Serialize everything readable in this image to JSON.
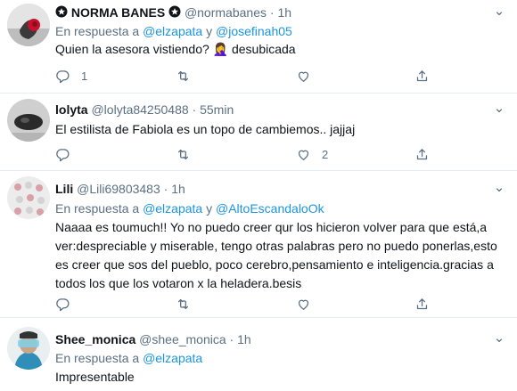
{
  "tweets": [
    {
      "name": "NORMA BANES",
      "name_prefix_icon": "star-badge-icon",
      "name_suffix_icon": "star-badge-icon",
      "handle": "@normabanes",
      "sep": "·",
      "time": "1h",
      "reply_prefix": "En respuesta a",
      "mention1": "@elzapata",
      "reply_join": "y",
      "mention2": "@josefinah05",
      "text": "Quien la asesora vistiendo? 🤦‍♀️ desubicada",
      "reply_count": "1",
      "retweet_count": "",
      "like_count": ""
    },
    {
      "name": "lolyta",
      "handle": "@lolyta84250488",
      "sep": "·",
      "time": "55min",
      "text": "El estilista de Fabiola es un topo de cambiemos.. jajjaj",
      "reply_count": "",
      "retweet_count": "",
      "like_count": "2"
    },
    {
      "name": "Lili",
      "handle": "@Lili69803483",
      "sep": "·",
      "time": "1h",
      "reply_prefix": "En respuesta a",
      "mention1": "@elzapata",
      "reply_join": "y",
      "mention2": "@AltoEscandaloOk",
      "text": "Naaaa es toumuch!! Yo no puedo creer qur los hicieron volver para que está,a ver:despreciable y miserable, tengo otras palabras pero no puedo ponerlas,esto es creer que sos del pueblo, poco cerebro,pensamiento e inteligencia.gracias a todos los que los votaron x la heladera.besis",
      "reply_count": "",
      "retweet_count": "",
      "like_count": ""
    },
    {
      "name": "Shee_monica",
      "handle": "@shee_monica",
      "sep": "·",
      "time": "1h",
      "reply_prefix": "En respuesta a",
      "mention1": "@elzapata",
      "text": "Impresentable"
    }
  ],
  "colors": {
    "text": "#0f1419",
    "secondary": "#5b7083",
    "link": "#1b95e0",
    "divider": "#e6ecf0"
  }
}
